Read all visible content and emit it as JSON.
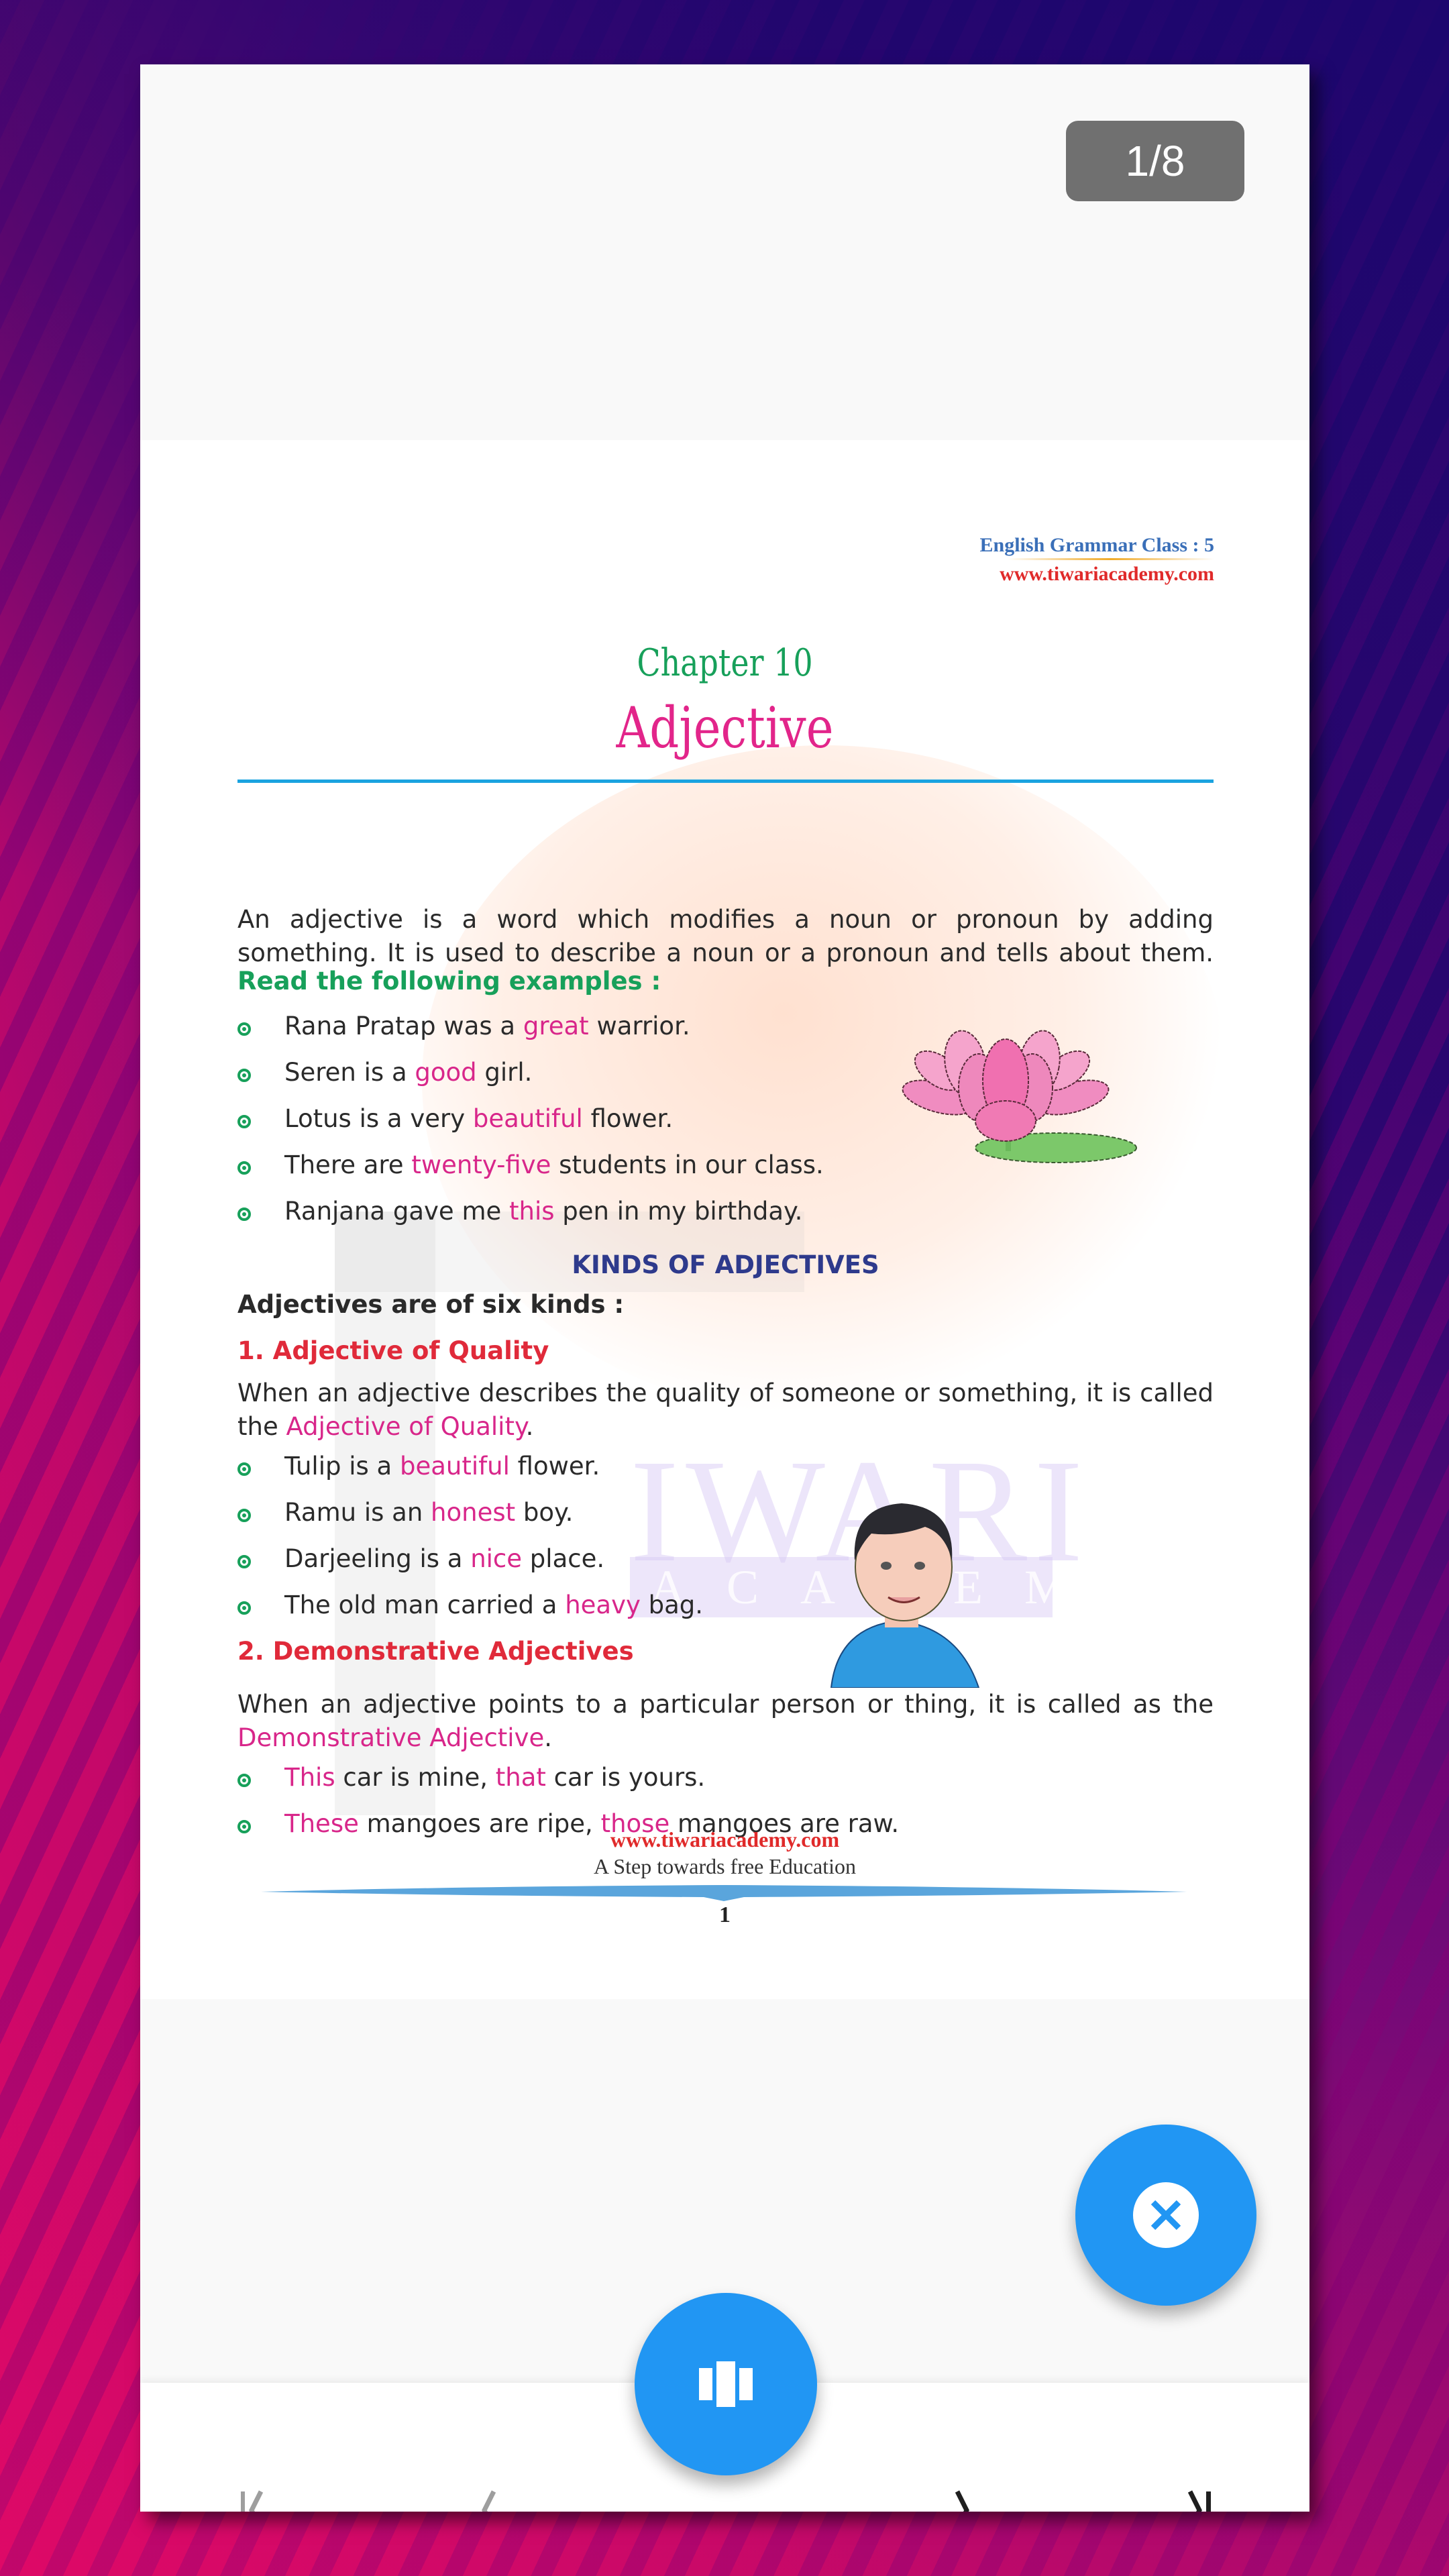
{
  "viewer": {
    "page_counter": "1/8",
    "current_page": 1,
    "total_pages": 8,
    "accent_color": "#2196f3"
  },
  "document": {
    "header": {
      "class_label": "English Grammar Class : 5",
      "site": "www.tiwariacademy.com"
    },
    "chapter": "Chapter 10",
    "title": "Adjective",
    "intro": "An adjective is a word which modifies a noun or pronoun by adding something. It is used to describe a noun or a pronoun and tells about them.",
    "examples_heading": "Read the following examples :",
    "examples": [
      {
        "before": "Rana Pratap was a ",
        "highlight": "great",
        "after": " warrior."
      },
      {
        "before": "Seren is a ",
        "highlight": "good",
        "after": " girl."
      },
      {
        "before": "Lotus is a very ",
        "highlight": "beautiful",
        "after": " flower."
      },
      {
        "before": "There are ",
        "highlight": "twenty-five",
        "after": " students in our class."
      },
      {
        "before": "Ranjana gave me ",
        "highlight": "this",
        "after": " pen in my birthday."
      }
    ],
    "kinds_heading": "KINDS OF ADJECTIVES",
    "kinds_intro": "Adjectives are of six kinds :",
    "section1": {
      "heading": "1. Adjective of Quality",
      "text_before": "When an adjective describes the quality of someone or something, it is called the ",
      "text_highlight": "Adjective of Quality",
      "text_after": ".",
      "examples": [
        {
          "before": "Tulip is a ",
          "highlight": "beautiful",
          "after": " flower."
        },
        {
          "before": "Ramu is an ",
          "highlight": "honest",
          "after": " boy."
        },
        {
          "before": "Darjeeling is a ",
          "highlight": "nice",
          "after": " place."
        },
        {
          "before": "The old man carried a ",
          "highlight": "heavy",
          "after": " bag."
        }
      ]
    },
    "section2": {
      "heading": "2. Demonstrative Adjectives",
      "text_before": "When an adjective points to a particular person or thing, it is called as the ",
      "text_highlight": "Demonstrative Adjective",
      "text_after": ".",
      "examples": [
        {
          "h1": "This",
          "mid": " car is mine, ",
          "h2": "that",
          "after": " car is yours."
        },
        {
          "h1": "These",
          "mid": " mangoes are ripe, ",
          "h2": "those",
          "after": " mangoes are raw."
        }
      ]
    },
    "watermark": {
      "line1": "IWARI",
      "line2": "ACADEMY"
    },
    "footer": {
      "site": "www.tiwariacademy.com",
      "tagline": "A Step towards free Education",
      "page_number": "1"
    }
  },
  "controls": {
    "close_icon": "close-circle-icon",
    "pages_icon": "view-carousel-icon",
    "nav": [
      {
        "name": "first-page",
        "icon": "first-page-icon",
        "enabled": false
      },
      {
        "name": "previous-page",
        "icon": "chevron-left-icon",
        "enabled": false
      },
      {
        "name": "next-page",
        "icon": "chevron-right-icon",
        "enabled": true
      },
      {
        "name": "last-page",
        "icon": "last-page-icon",
        "enabled": true
      }
    ]
  }
}
